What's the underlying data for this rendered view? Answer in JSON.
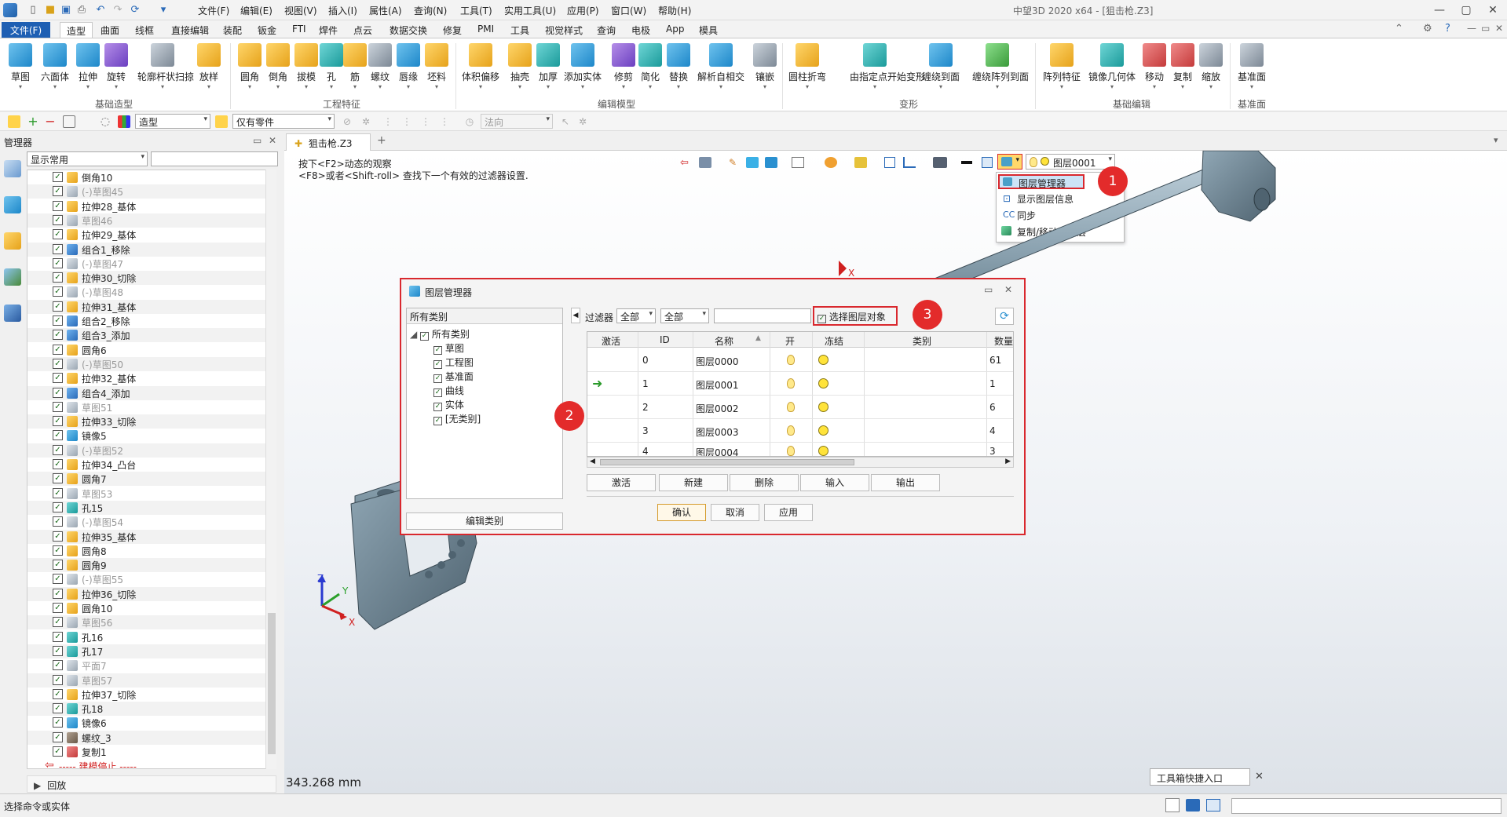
{
  "titlebar": {
    "menus": [
      "文件(F)",
      "编辑(E)",
      "视图(V)",
      "插入(I)",
      "属性(A)",
      "查询(N)",
      "工具(T)",
      "实用工具(U)",
      "应用(P)",
      "窗口(W)",
      "帮助(H)"
    ],
    "app_title": "中望3D 2020 x64 - [狙击枪.Z3]"
  },
  "ribbon_tabs": [
    "文件(F)",
    "造型",
    "曲面",
    "线框",
    "直接编辑",
    "装配",
    "钣金",
    "FTI",
    "焊件",
    "点云",
    "数据交换",
    "修复",
    "PMI",
    "工具",
    "视觉样式",
    "查询",
    "电极",
    "App",
    "模具"
  ],
  "ribbon": {
    "groups": [
      {
        "label": "基础造型",
        "buttons": [
          "草图",
          "六面体",
          "拉伸",
          "旋转",
          "轮廓杆状扫掠",
          "放样"
        ]
      },
      {
        "label": "工程特征",
        "buttons": [
          "圆角",
          "倒角",
          "拔模",
          "孔",
          "筋",
          "螺纹",
          "唇缘",
          "坯料"
        ]
      },
      {
        "label": "编辑模型",
        "buttons": [
          "体积偏移",
          "抽壳",
          "加厚",
          "添加实体",
          "修剪",
          "简化",
          "替换",
          "解析自相交",
          "镶嵌"
        ]
      },
      {
        "label": "变形",
        "buttons": [
          "圆柱折弯",
          "由指定点开始变形",
          "缠绕到面",
          "缠绕阵列到面"
        ]
      },
      {
        "label": "基础编辑",
        "buttons": [
          "阵列特征",
          "镜像几何体",
          "移动",
          "复制",
          "缩放"
        ]
      },
      {
        "label": "基准面",
        "buttons": [
          "基准面"
        ]
      }
    ]
  },
  "toolbar2": {
    "mode_combo": "造型",
    "filter_combo": "仅有零件",
    "direction_combo": "法向"
  },
  "manager": {
    "title": "管理器",
    "display_combo": "显示常用",
    "tree": [
      {
        "label": "倒角10",
        "dim": false
      },
      {
        "label": "(-)草图45",
        "dim": true
      },
      {
        "label": "拉伸28_基体",
        "dim": false
      },
      {
        "label": "草图46",
        "dim": true
      },
      {
        "label": "拉伸29_基体",
        "dim": false
      },
      {
        "label": "组合1_移除",
        "dim": false
      },
      {
        "label": "(-)草图47",
        "dim": true
      },
      {
        "label": "拉伸30_切除",
        "dim": false
      },
      {
        "label": "(-)草图48",
        "dim": true
      },
      {
        "label": "拉伸31_基体",
        "dim": false
      },
      {
        "label": "组合2_移除",
        "dim": false
      },
      {
        "label": "组合3_添加",
        "dim": false
      },
      {
        "label": "圆角6",
        "dim": false
      },
      {
        "label": "(-)草图50",
        "dim": true
      },
      {
        "label": "拉伸32_基体",
        "dim": false
      },
      {
        "label": "组合4_添加",
        "dim": false
      },
      {
        "label": "草图51",
        "dim": true
      },
      {
        "label": "拉伸33_切除",
        "dim": false
      },
      {
        "label": "镜像5",
        "dim": false
      },
      {
        "label": "(-)草图52",
        "dim": true
      },
      {
        "label": "拉伸34_凸台",
        "dim": false
      },
      {
        "label": "圆角7",
        "dim": false
      },
      {
        "label": "草图53",
        "dim": true
      },
      {
        "label": "孔15",
        "dim": false
      },
      {
        "label": "(-)草图54",
        "dim": true
      },
      {
        "label": "拉伸35_基体",
        "dim": false
      },
      {
        "label": "圆角8",
        "dim": false
      },
      {
        "label": "圆角9",
        "dim": false
      },
      {
        "label": "(-)草图55",
        "dim": true
      },
      {
        "label": "拉伸36_切除",
        "dim": false
      },
      {
        "label": "圆角10",
        "dim": false
      },
      {
        "label": "草图56",
        "dim": true
      },
      {
        "label": "孔16",
        "dim": false
      },
      {
        "label": "孔17",
        "dim": false
      },
      {
        "label": "平面7",
        "dim": true
      },
      {
        "label": "草图57",
        "dim": true
      },
      {
        "label": "拉伸37_切除",
        "dim": false
      },
      {
        "label": "孔18",
        "dim": false
      },
      {
        "label": "镜像6",
        "dim": false
      },
      {
        "label": "螺纹_3",
        "dim": false
      },
      {
        "label": "复制1",
        "dim": false
      }
    ],
    "stop_marker": "----- 建模停止 -----",
    "rollback": "回放"
  },
  "document_tab": "狙击枪.Z3",
  "viewport": {
    "hint1": "按下<F2>动态的观察",
    "hint2": "<F8>或者<Shift-roll> 查找下一个有效的过滤器设置.",
    "layer_combo": "图层0001",
    "measure": "343.268 mm",
    "axes": {
      "x": "X",
      "y": "Y",
      "z": "Z"
    }
  },
  "layer_menu": {
    "items": [
      "图层管理器",
      "显示图层信息",
      "同步",
      "复制/移动到图层"
    ]
  },
  "callouts": [
    "1",
    "2",
    "3"
  ],
  "dialog": {
    "title": "图层管理器",
    "category_header": "所有类别",
    "categories_root": "所有类别",
    "categories": [
      "草图",
      "工程图",
      "基准面",
      "曲线",
      "实体",
      "[无类别]"
    ],
    "edit_category_button": "编辑类别",
    "filter_label": "过滤器",
    "filter_combo1": "全部",
    "filter_combo2": "全部",
    "select_layer_objects": "选择图层对象",
    "columns": [
      "激活",
      "ID",
      "名称",
      "开",
      "冻结",
      "类别",
      "数量"
    ],
    "rows": [
      {
        "id": "0",
        "name": "图层0000",
        "count": "61",
        "active": false
      },
      {
        "id": "1",
        "name": "图层0001",
        "count": "1",
        "active": true
      },
      {
        "id": "2",
        "name": "图层0002",
        "count": "6",
        "active": false
      },
      {
        "id": "3",
        "name": "图层0003",
        "count": "4",
        "active": false
      },
      {
        "id": "4",
        "name": "图层0004",
        "count": "3",
        "active": false
      }
    ],
    "action_buttons": [
      "激活",
      "新建",
      "删除",
      "输入",
      "输出"
    ],
    "ok_button": "确认",
    "cancel_button": "取消",
    "apply_button": "应用"
  },
  "status": {
    "left_text": "选择命令或实体",
    "toolbox_entry": "工具箱快捷入口"
  }
}
